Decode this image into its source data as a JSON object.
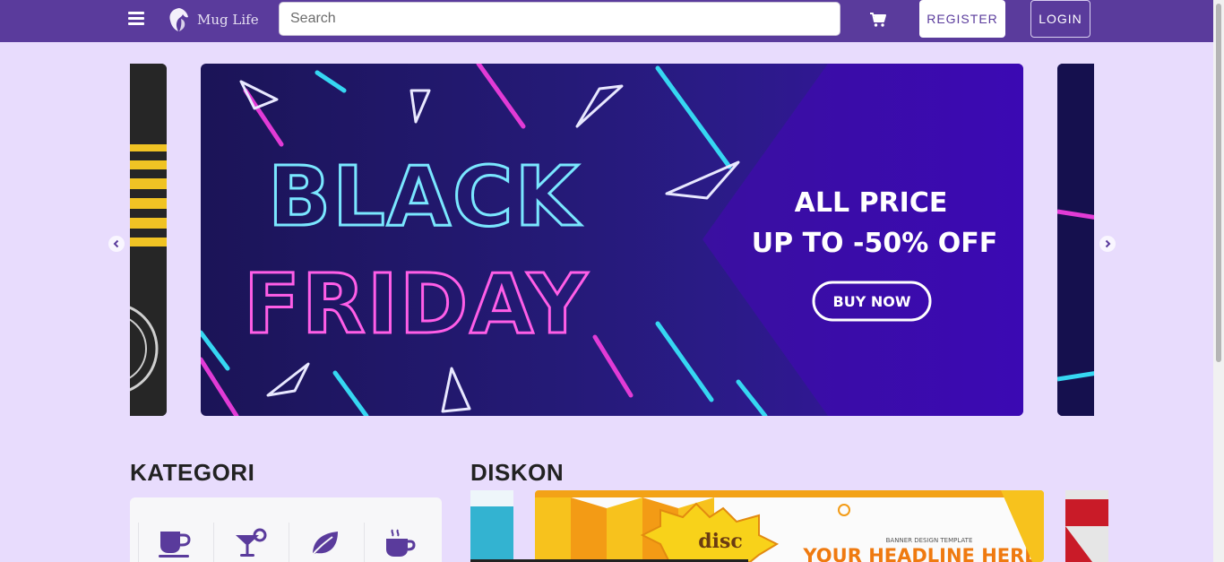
{
  "navbar": {
    "menu_icon": "hamburger-menu-icon",
    "brand_name": "Mug Life",
    "brand_logo_icon": "lion-logo-icon",
    "search_placeholder": "Search",
    "cart_icon": "shopping-cart-icon",
    "register_label": "REGISTER",
    "login_label": "LOGIN"
  },
  "carousel": {
    "main_banner": {
      "headline_1": "BLACK",
      "headline_2": "FRIDAY",
      "offer_1": "ALL PRICE",
      "offer_2": "UP TO -50% OFF",
      "cta": "BUY NOW"
    },
    "prev_icon": "chevron-left-icon",
    "next_icon": "chevron-right-icon"
  },
  "kategori": {
    "title": "KATEGORI",
    "items": [
      {
        "icon": "coffee-mug-icon"
      },
      {
        "icon": "cocktail-glass-icon"
      },
      {
        "icon": "leaf-icon"
      },
      {
        "icon": "hot-cup-icon"
      }
    ]
  },
  "diskon": {
    "title": "DISKON",
    "banner": {
      "badge": "disc",
      "sub": "BANNER DESIGN TEMPLATE",
      "headline": "YOUR HEADLINE HERE"
    }
  },
  "colors": {
    "navbar": "#5a3b9c",
    "page_bg": "#e8dcfd",
    "accent_neon_pink": "#e23bd6",
    "accent_neon_cyan": "#36d7f2"
  }
}
